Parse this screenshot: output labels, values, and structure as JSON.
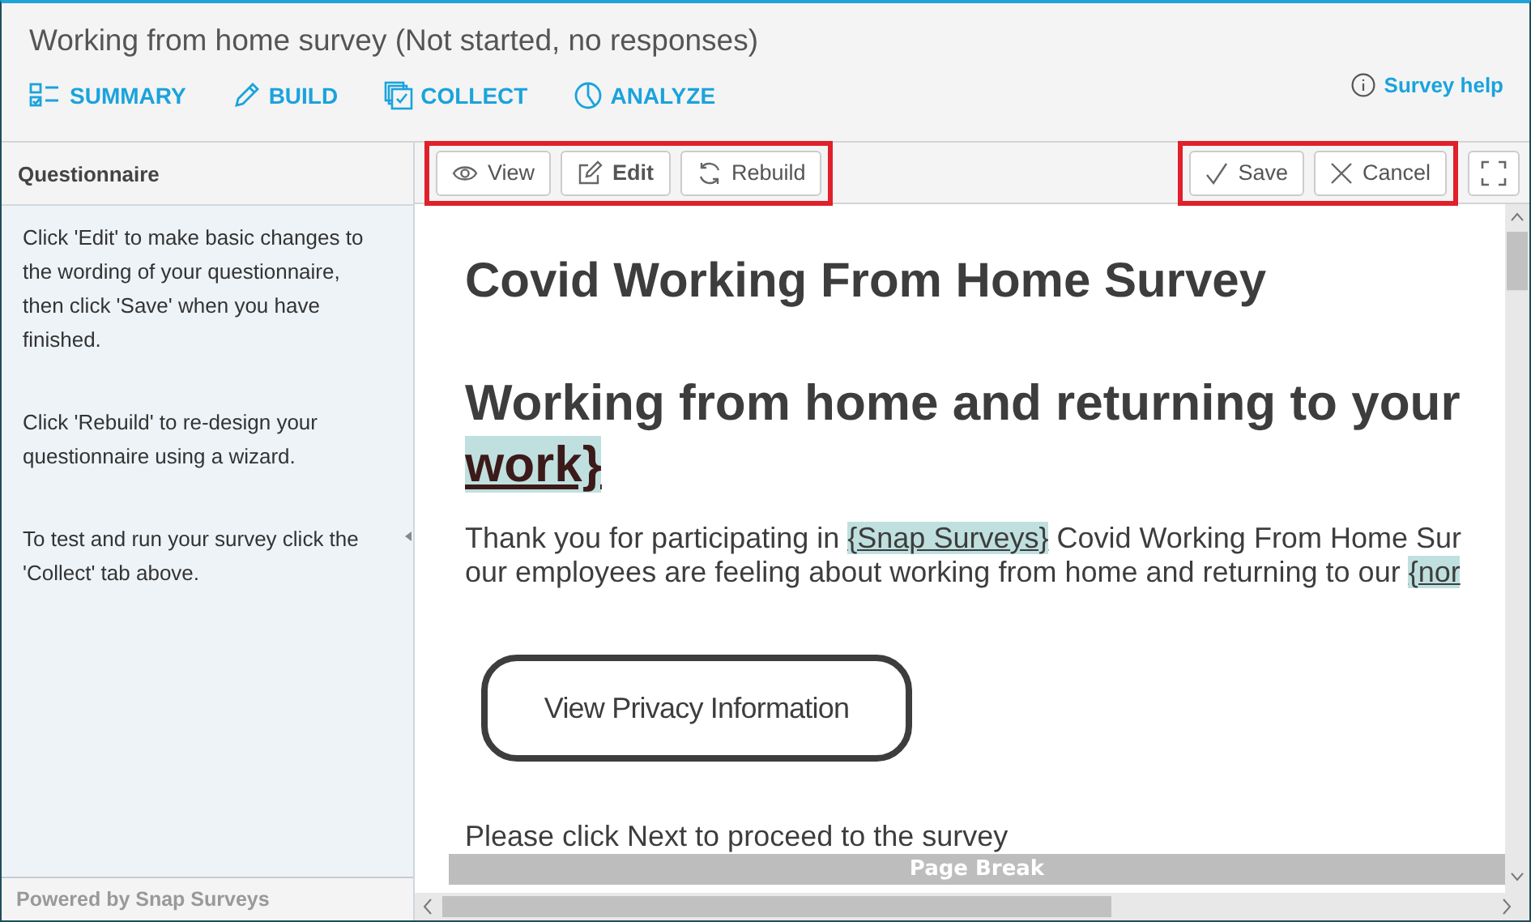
{
  "window": {
    "title": "Working from home survey (Not started, no responses)"
  },
  "tabs": [
    {
      "label": "SUMMARY",
      "kind": "summary"
    },
    {
      "label": "BUILD",
      "kind": "build"
    },
    {
      "label": "COLLECT",
      "kind": "collect"
    },
    {
      "label": "ANALYZE",
      "kind": "analyze"
    }
  ],
  "help_link": "Survey help",
  "sidebar": {
    "title": "Questionnaire",
    "paragraphs": [
      "Click 'Edit' to make basic changes to the wording of your questionnaire, then click 'Save' when you have finished.",
      "Click 'Rebuild' to re-design your questionnaire using a wizard.",
      "To test and run your survey click the 'Collect' tab above."
    ],
    "footer": "Powered by Snap Surveys"
  },
  "toolbar": {
    "left": [
      {
        "label": "View",
        "kind": "view",
        "bold": false
      },
      {
        "label": "Edit",
        "kind": "edit",
        "bold": true
      },
      {
        "label": "Rebuild",
        "kind": "rebuild",
        "bold": false
      }
    ],
    "right": [
      {
        "label": "Save",
        "kind": "save",
        "bold": false
      },
      {
        "label": "Cancel",
        "kind": "cancel",
        "bold": false
      }
    ]
  },
  "document": {
    "title": "Covid Working From Home Survey",
    "heading_lines": [
      [
        {
          "text": "Working from home and returning to your",
          "kind": "text"
        }
      ],
      [
        {
          "text": "work}",
          "kind": "field"
        }
      ]
    ],
    "intro_lines": [
      [
        {
          "text": "Thank you for participating in ",
          "kind": "text"
        },
        {
          "text": "{Snap Surveys}",
          "kind": "field"
        },
        {
          "text": " Covid Working From Home Sur",
          "kind": "text"
        }
      ],
      [
        {
          "text": "our employees are feeling about working from home and returning to our ",
          "kind": "text"
        },
        {
          "text": "{nor",
          "kind": "field"
        }
      ]
    ],
    "privacy_button": "View Privacy Information",
    "instruction": "Please click Next to proceed to the survey",
    "page_break": "Page Break"
  }
}
